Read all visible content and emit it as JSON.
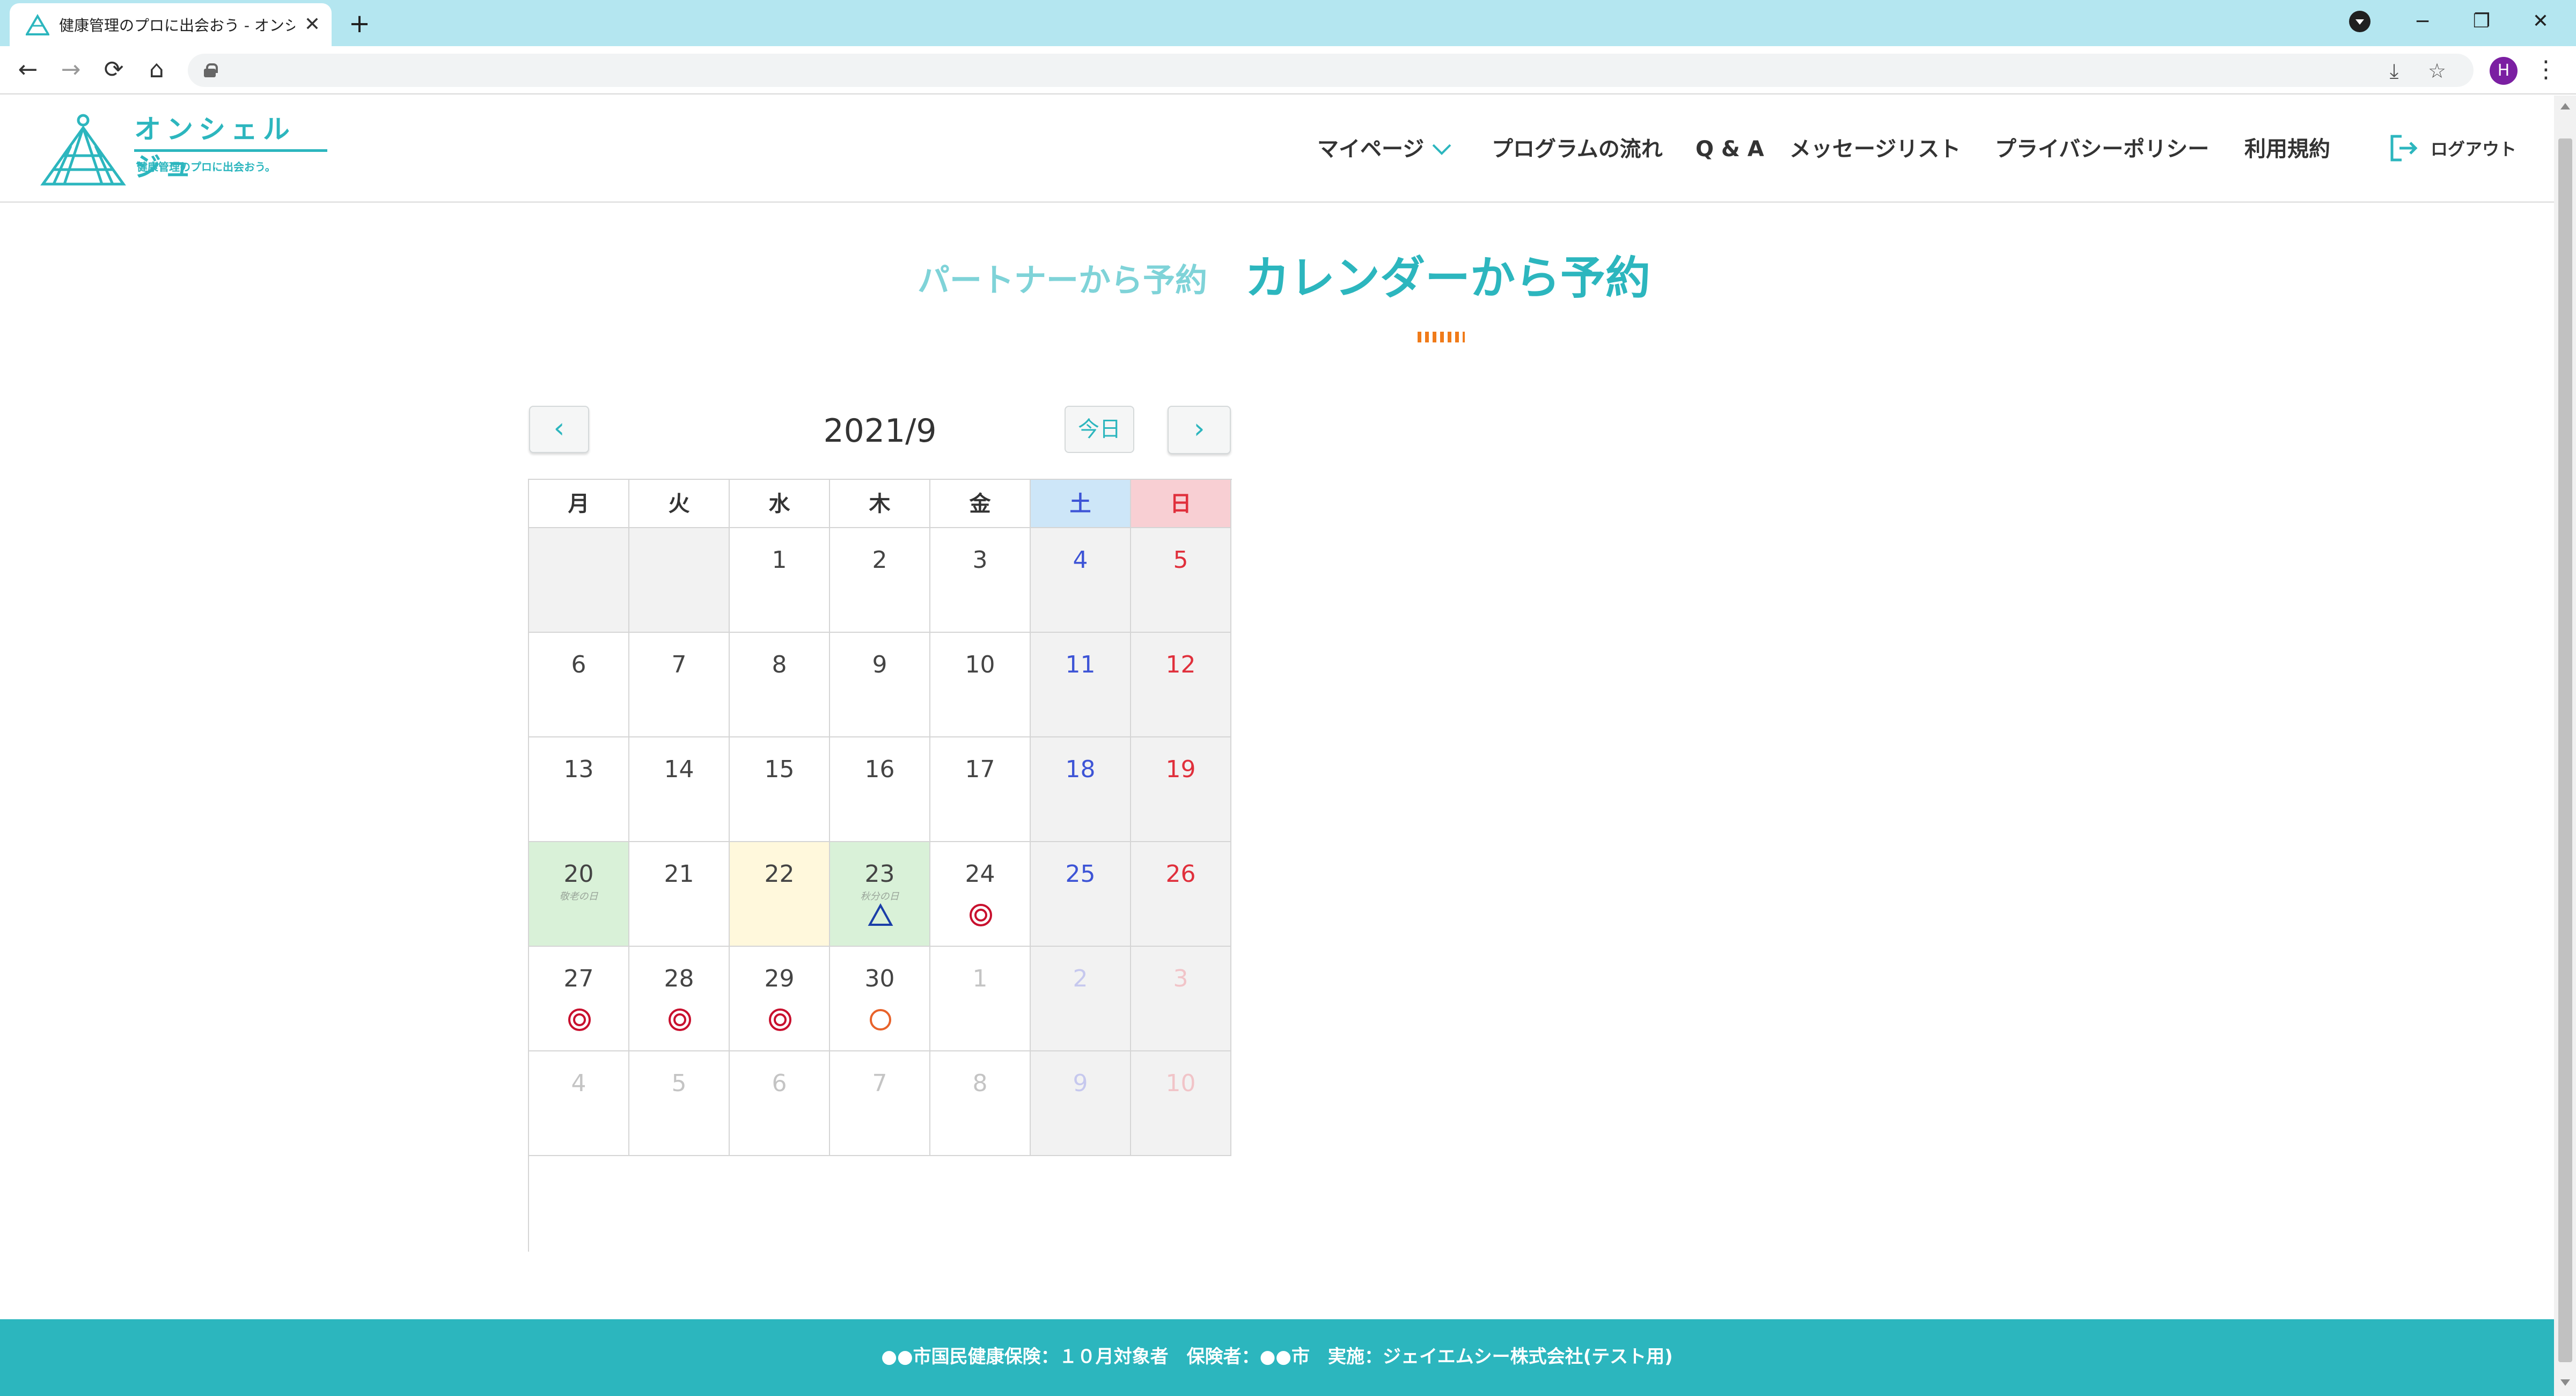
{
  "browser": {
    "tab_title": "健康管理のプロに出会おう - オンシェ",
    "new_tab": "+",
    "close": "✕",
    "minimize": "−",
    "maximize": "❐",
    "window_close": "✕",
    "back": "←",
    "forward": "→",
    "reload": "⟳",
    "home": "⌂",
    "install": "⤓",
    "star": "☆",
    "avatar_initial": "H",
    "menu": "⋮"
  },
  "header": {
    "logo_title": "オンシェルジュ",
    "logo_subtitle": "健康管理のプロに出会おう。",
    "nav": [
      "マイページ",
      "プログラムの流れ",
      "Q & A",
      "メッセージリスト",
      "プライバシーポリシー",
      "利用規約"
    ],
    "logout": "ログアウト"
  },
  "switcher": {
    "partner": "パートナーから予約",
    "calendar": "カレンダーから予約"
  },
  "calendar": {
    "month": "2021/9",
    "today": "今日",
    "prev": "‹",
    "next": "›",
    "weekdays": [
      "月",
      "火",
      "水",
      "木",
      "金",
      "土",
      "日"
    ],
    "weeks": [
      [
        {
          "d": ""
        },
        {
          "d": ""
        },
        {
          "d": "1"
        },
        {
          "d": "2"
        },
        {
          "d": "3"
        },
        {
          "d": "4"
        },
        {
          "d": "5"
        }
      ],
      [
        {
          "d": "6"
        },
        {
          "d": "7"
        },
        {
          "d": "8"
        },
        {
          "d": "9"
        },
        {
          "d": "10"
        },
        {
          "d": "11"
        },
        {
          "d": "12"
        }
      ],
      [
        {
          "d": "13"
        },
        {
          "d": "14"
        },
        {
          "d": "15"
        },
        {
          "d": "16"
        },
        {
          "d": "17"
        },
        {
          "d": "18"
        },
        {
          "d": "19"
        }
      ],
      [
        {
          "d": "20",
          "holiday": "敬老の日",
          "bg": "green"
        },
        {
          "d": "21"
        },
        {
          "d": "22",
          "bg": "yellow"
        },
        {
          "d": "23",
          "holiday": "秋分の日",
          "bg": "green",
          "mark": "triangle"
        },
        {
          "d": "24",
          "mark": "double-circle"
        },
        {
          "d": "25"
        },
        {
          "d": "26"
        }
      ],
      [
        {
          "d": "27",
          "mark": "double-circle"
        },
        {
          "d": "28",
          "mark": "double-circle"
        },
        {
          "d": "29",
          "mark": "double-circle"
        },
        {
          "d": "30",
          "mark": "circle"
        },
        {
          "d": "1",
          "other": true
        },
        {
          "d": "2",
          "other": true
        },
        {
          "d": "3",
          "other": true
        }
      ],
      [
        {
          "d": "4",
          "other": true
        },
        {
          "d": "5",
          "other": true
        },
        {
          "d": "6",
          "other": true
        },
        {
          "d": "7",
          "other": true
        },
        {
          "d": "8",
          "other": true
        },
        {
          "d": "9",
          "other": true
        },
        {
          "d": "10",
          "other": true
        }
      ]
    ]
  },
  "footer": {
    "text": "●●市国民健康保険：１０月対象者　保険者：●●市　実施：ジェイエムシー株式会社(テスト用)"
  },
  "colors": {
    "brand": "#2cb6be",
    "saturday": "#3d54d6",
    "sunday": "#e0303c",
    "mark_red": "#c8102e",
    "mark_blue": "#1a3ea8",
    "mark_orange": "#e8622a"
  }
}
